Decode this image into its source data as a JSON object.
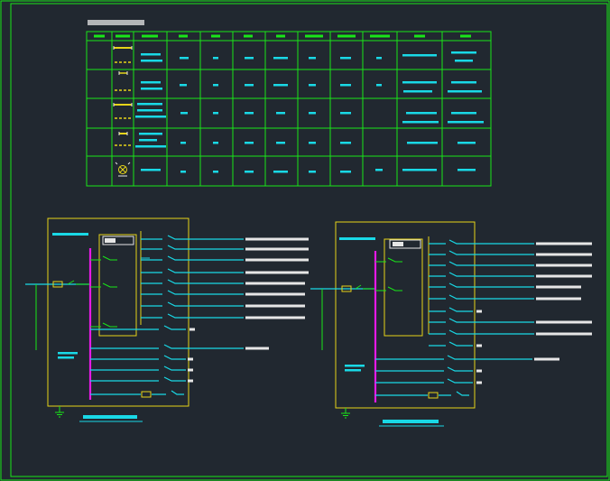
{
  "colors": {
    "background": "#212830",
    "frame": "#19e619",
    "busbar": "#e619e6",
    "feeder": "#19d9e6",
    "cabinet": "#e6d419",
    "symbol": "#e6e6e6"
  },
  "drawing": {
    "title": "",
    "table": {
      "rows": 5,
      "columns": 12,
      "cells": []
    },
    "panel_left": {
      "name": "",
      "caption": "",
      "circuits": []
    },
    "panel_right": {
      "name": "",
      "caption": "",
      "circuits": []
    }
  }
}
